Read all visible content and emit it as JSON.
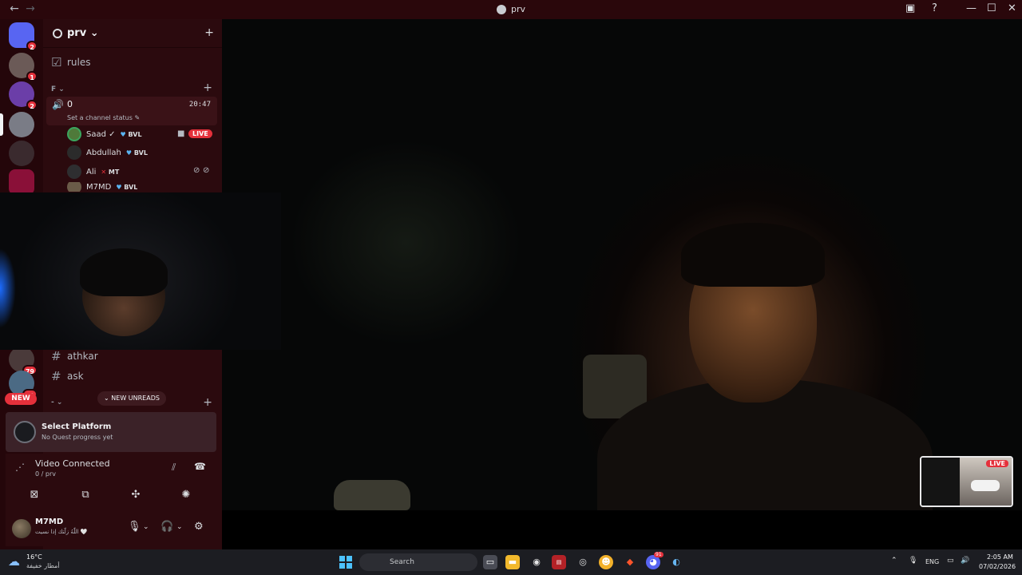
{
  "window": {
    "title": "prv",
    "back_label": "←",
    "forward_label": "→",
    "inbox_icon": "inbox-icon",
    "help_label": "?",
    "minimize_label": "—",
    "maximize_label": "☐",
    "close_label": "✕"
  },
  "rail": {
    "servers": [
      {
        "name": "discord-home",
        "badge": "2",
        "color": "#5865f2"
      },
      {
        "name": "server-1",
        "badge": "1",
        "color": "#6b5a57"
      },
      {
        "name": "server-2",
        "badge": "2",
        "color": "#6b3ea8"
      },
      {
        "name": "server-3",
        "badge": "",
        "color": "#7a7c86"
      },
      {
        "name": "server-4",
        "badge": "",
        "color": "#3a2a2e"
      },
      {
        "name": "server-5",
        "badge": "",
        "color": "#8a1038"
      },
      {
        "name": "server-athkar",
        "badge": "79",
        "color": "#4a3a3a"
      },
      {
        "name": "server-ask",
        "badge": "11",
        "color": "#4b6a84"
      }
    ],
    "new_badge": "NEW"
  },
  "guild": {
    "name": "prv",
    "chevron": "⌄",
    "invite_label": "+"
  },
  "channels": {
    "rules_label": "rules",
    "category_f": "F ⌄",
    "category_plus": "+",
    "voice_channel": "0",
    "voice_time": "20:47",
    "voice_status": "Set a channel status ✎",
    "voice_users": [
      {
        "name": "Saad ✓",
        "tag": "BVL",
        "color": "#4f7a3a"
      },
      {
        "name": "Abdullah",
        "tag": "BVL",
        "color": "#2b2b2b"
      },
      {
        "name": "Ali",
        "tag": "MT",
        "color": "#2e2e30"
      },
      {
        "name": "M7MD",
        "tag": "BVL",
        "color": "#6a5b48"
      }
    ],
    "live_label": "LIVE",
    "text_channels": [
      {
        "label": "athkar"
      },
      {
        "label": "ask"
      }
    ],
    "category_dash": "- ⌄",
    "new_unreads": "⌄ NEW UNREADS"
  },
  "quest": {
    "title": "Select Platform",
    "subtitle": "No Quest progress yet"
  },
  "voice_panel": {
    "title": "Video Connected",
    "subtitle": "0 / prv"
  },
  "user": {
    "name": "M7MD",
    "status": "اللّٰهُ زلّتك إذا نسيت 🤍"
  },
  "stream": {
    "pip_live": "LIVE"
  },
  "taskbar": {
    "weather_temp": "16°C",
    "weather_desc": "أمطار خفيفة",
    "search_placeholder": "Search",
    "lang": "ENG",
    "time": "2:05 AM",
    "date": "07/02/2026",
    "discord_badge": "91"
  },
  "colors": {
    "accent": "#e5303b",
    "titlebar": "#2a070b",
    "sidebar": "#2b0a0e",
    "rail": "#24060a"
  }
}
